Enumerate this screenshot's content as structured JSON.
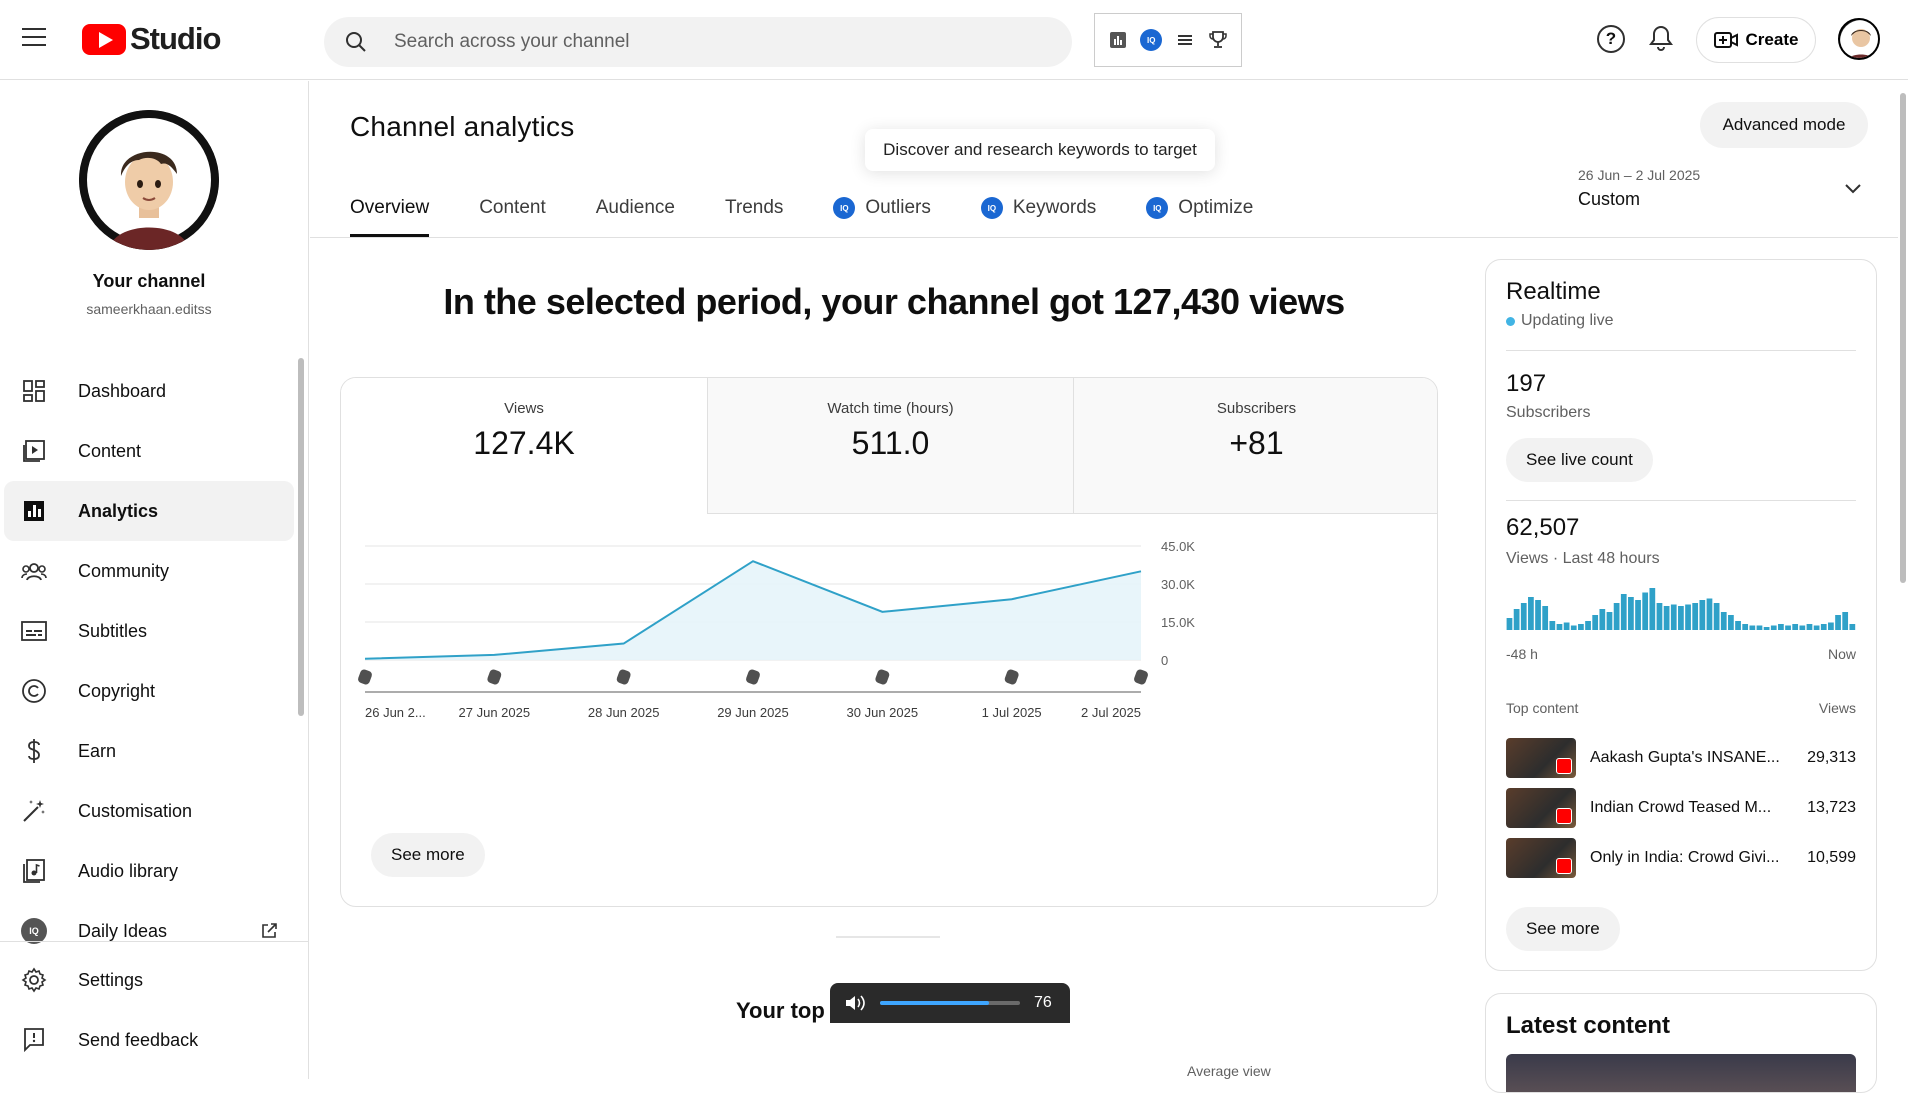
{
  "app": {
    "brand": "Studio",
    "search_placeholder": "Search across your channel",
    "create_label": "Create"
  },
  "sidebar": {
    "channel_name": "Your channel",
    "channel_handle": "sameerkhaan.editss",
    "items": [
      {
        "label": "Dashboard",
        "icon": "dashboard-icon"
      },
      {
        "label": "Content",
        "icon": "content-icon"
      },
      {
        "label": "Analytics",
        "icon": "analytics-icon",
        "active": true
      },
      {
        "label": "Community",
        "icon": "community-icon"
      },
      {
        "label": "Subtitles",
        "icon": "subtitles-icon"
      },
      {
        "label": "Copyright",
        "icon": "copyright-icon"
      },
      {
        "label": "Earn",
        "icon": "earn-icon"
      },
      {
        "label": "Customisation",
        "icon": "customisation-icon"
      },
      {
        "label": "Audio library",
        "icon": "audio-library-icon"
      },
      {
        "label": "Daily Ideas",
        "icon": "daily-ideas-icon"
      }
    ],
    "bottom_items": [
      {
        "label": "Settings",
        "icon": "gear-icon"
      },
      {
        "label": "Send feedback",
        "icon": "feedback-icon"
      }
    ]
  },
  "main": {
    "title": "Channel analytics",
    "tooltip": "Discover and research keywords to target",
    "advanced_mode": "Advanced mode",
    "tabs": [
      {
        "label": "Overview",
        "active": true
      },
      {
        "label": "Content"
      },
      {
        "label": "Audience"
      },
      {
        "label": "Trends"
      },
      {
        "label": "Outliers",
        "badge": "iq"
      },
      {
        "label": "Keywords",
        "badge": "iq"
      },
      {
        "label": "Optimize",
        "badge": "iq"
      }
    ],
    "date_range": {
      "range": "26 Jun – 2 Jul 2025",
      "label": "Custom"
    },
    "headline": "In the selected period, your channel got 127,430 views",
    "metrics": [
      {
        "label": "Views",
        "value": "127.4K"
      },
      {
        "label": "Watch time (hours)",
        "value": "511.0"
      },
      {
        "label": "Subscribers",
        "value": "+81"
      }
    ],
    "see_more": "See more",
    "your_top": "Your top",
    "average_view": "Average view",
    "volume": {
      "value": "76",
      "level": 0.78
    }
  },
  "chart_data": {
    "type": "area",
    "x": [
      "26 Jun 2...",
      "27 Jun 2025",
      "28 Jun 2025",
      "29 Jun 2025",
      "30 Jun 2025",
      "1 Jul 2025",
      "2 Jul 2025"
    ],
    "y_tick_labels": [
      "0",
      "15.0K",
      "30.0K",
      "45.0K"
    ],
    "y_ticks": [
      0,
      15000,
      30000,
      45000
    ],
    "series": [
      {
        "values": [
          500,
          2000,
          6500,
          39000,
          19000,
          24000,
          35000
        ]
      }
    ],
    "ylim": [
      0,
      45000
    ],
    "grid": true,
    "color": "#2fa1c8"
  },
  "realtime": {
    "title": "Realtime",
    "status": "Updating live",
    "subs_count": "197",
    "subs_label": "Subscribers",
    "live_count_btn": "See live count",
    "views_count": "62,507",
    "views_label": "Views · Last 48 hours",
    "axis_start": "-48 h",
    "axis_end": "Now",
    "top_content_label": "Top content",
    "views_col_label": "Views",
    "hourly_views": [
      8,
      14,
      18,
      22,
      20,
      16,
      6,
      4,
      5,
      3,
      4,
      6,
      10,
      14,
      12,
      18,
      24,
      22,
      20,
      25,
      28,
      18,
      16,
      17,
      16,
      17,
      18,
      20,
      21,
      18,
      12,
      10,
      6,
      4,
      3,
      3,
      2,
      3,
      4,
      3,
      4,
      3,
      4,
      3,
      4,
      5,
      10,
      12,
      4
    ],
    "top_content": [
      {
        "title": "Aakash Gupta's INSANE...",
        "views": "29,313"
      },
      {
        "title": "Indian Crowd Teased M...",
        "views": "13,723"
      },
      {
        "title": "Only in India: Crowd Givi...",
        "views": "10,599"
      }
    ],
    "see_more": "See more"
  },
  "latest": {
    "title": "Latest content"
  }
}
